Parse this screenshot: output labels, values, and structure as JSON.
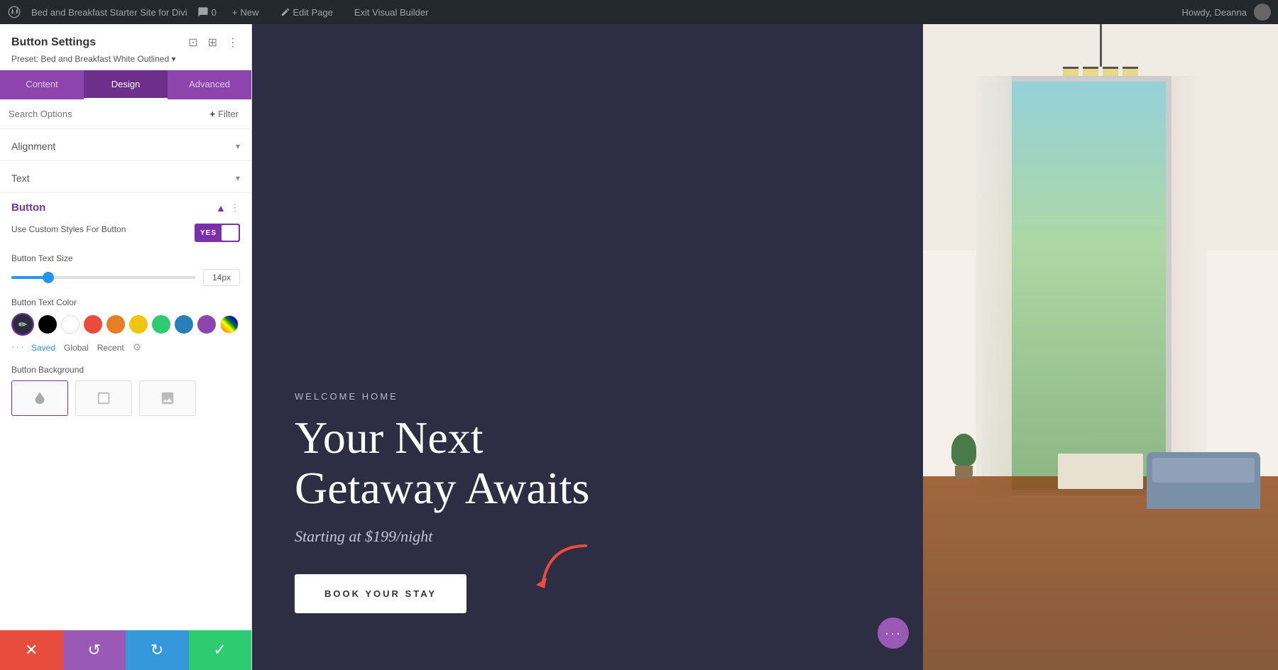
{
  "admin_bar": {
    "site_name": "Bed and Breakfast Starter Site for Divi",
    "comment_count": "0",
    "new_label": "New",
    "edit_page_label": "Edit Page",
    "exit_builder_label": "Exit Visual Builder",
    "howdy": "Howdy, Deanna"
  },
  "panel": {
    "title": "Button Settings",
    "preset_label": "Preset: Bed and Breakfast White Outlined",
    "tabs": [
      {
        "id": "content",
        "label": "Content"
      },
      {
        "id": "design",
        "label": "Design"
      },
      {
        "id": "advanced",
        "label": "Advanced"
      }
    ],
    "active_tab": "design",
    "search_placeholder": "Search Options",
    "filter_label": "Filter",
    "sections": {
      "alignment": {
        "title": "Alignment",
        "collapsed": true
      },
      "text": {
        "title": "Text",
        "collapsed": true
      },
      "button": {
        "title": "Button",
        "custom_styles_label": "Use Custom Styles For Button",
        "toggle_yes": "YES",
        "toggle_enabled": true,
        "text_size_label": "Button Text Size",
        "text_size_value": "14px",
        "text_color_label": "Button Text Color",
        "colors": [
          {
            "id": "dark",
            "hex": "#2c2c3c"
          },
          {
            "id": "black",
            "hex": "#000000"
          },
          {
            "id": "white",
            "hex": "#ffffff"
          },
          {
            "id": "red",
            "hex": "#e74c3c"
          },
          {
            "id": "orange",
            "hex": "#e67e22"
          },
          {
            "id": "yellow",
            "hex": "#f1c40f"
          },
          {
            "id": "green",
            "hex": "#2ecc71"
          },
          {
            "id": "blue",
            "hex": "#2980b9"
          },
          {
            "id": "purple",
            "hex": "#8e44ad"
          },
          {
            "id": "stripe",
            "hex": "gradient"
          }
        ],
        "color_tabs": [
          "Saved",
          "Global",
          "Recent"
        ],
        "active_color_tab": "Saved",
        "bg_label": "Button Background"
      }
    },
    "bottom_bar": {
      "close_label": "✕",
      "undo_label": "↺",
      "redo_label": "↻",
      "save_label": "✓"
    }
  },
  "hero": {
    "welcome_tag": "WELCOME HOME",
    "title_line1": "Your Next",
    "title_line2": "Getaway Awaits",
    "subtitle": "Starting at $199/night",
    "book_btn_label": "BOOK YOUR STAY"
  },
  "canvas_bg_color": "#2d2d44",
  "dots_btn_label": "···"
}
